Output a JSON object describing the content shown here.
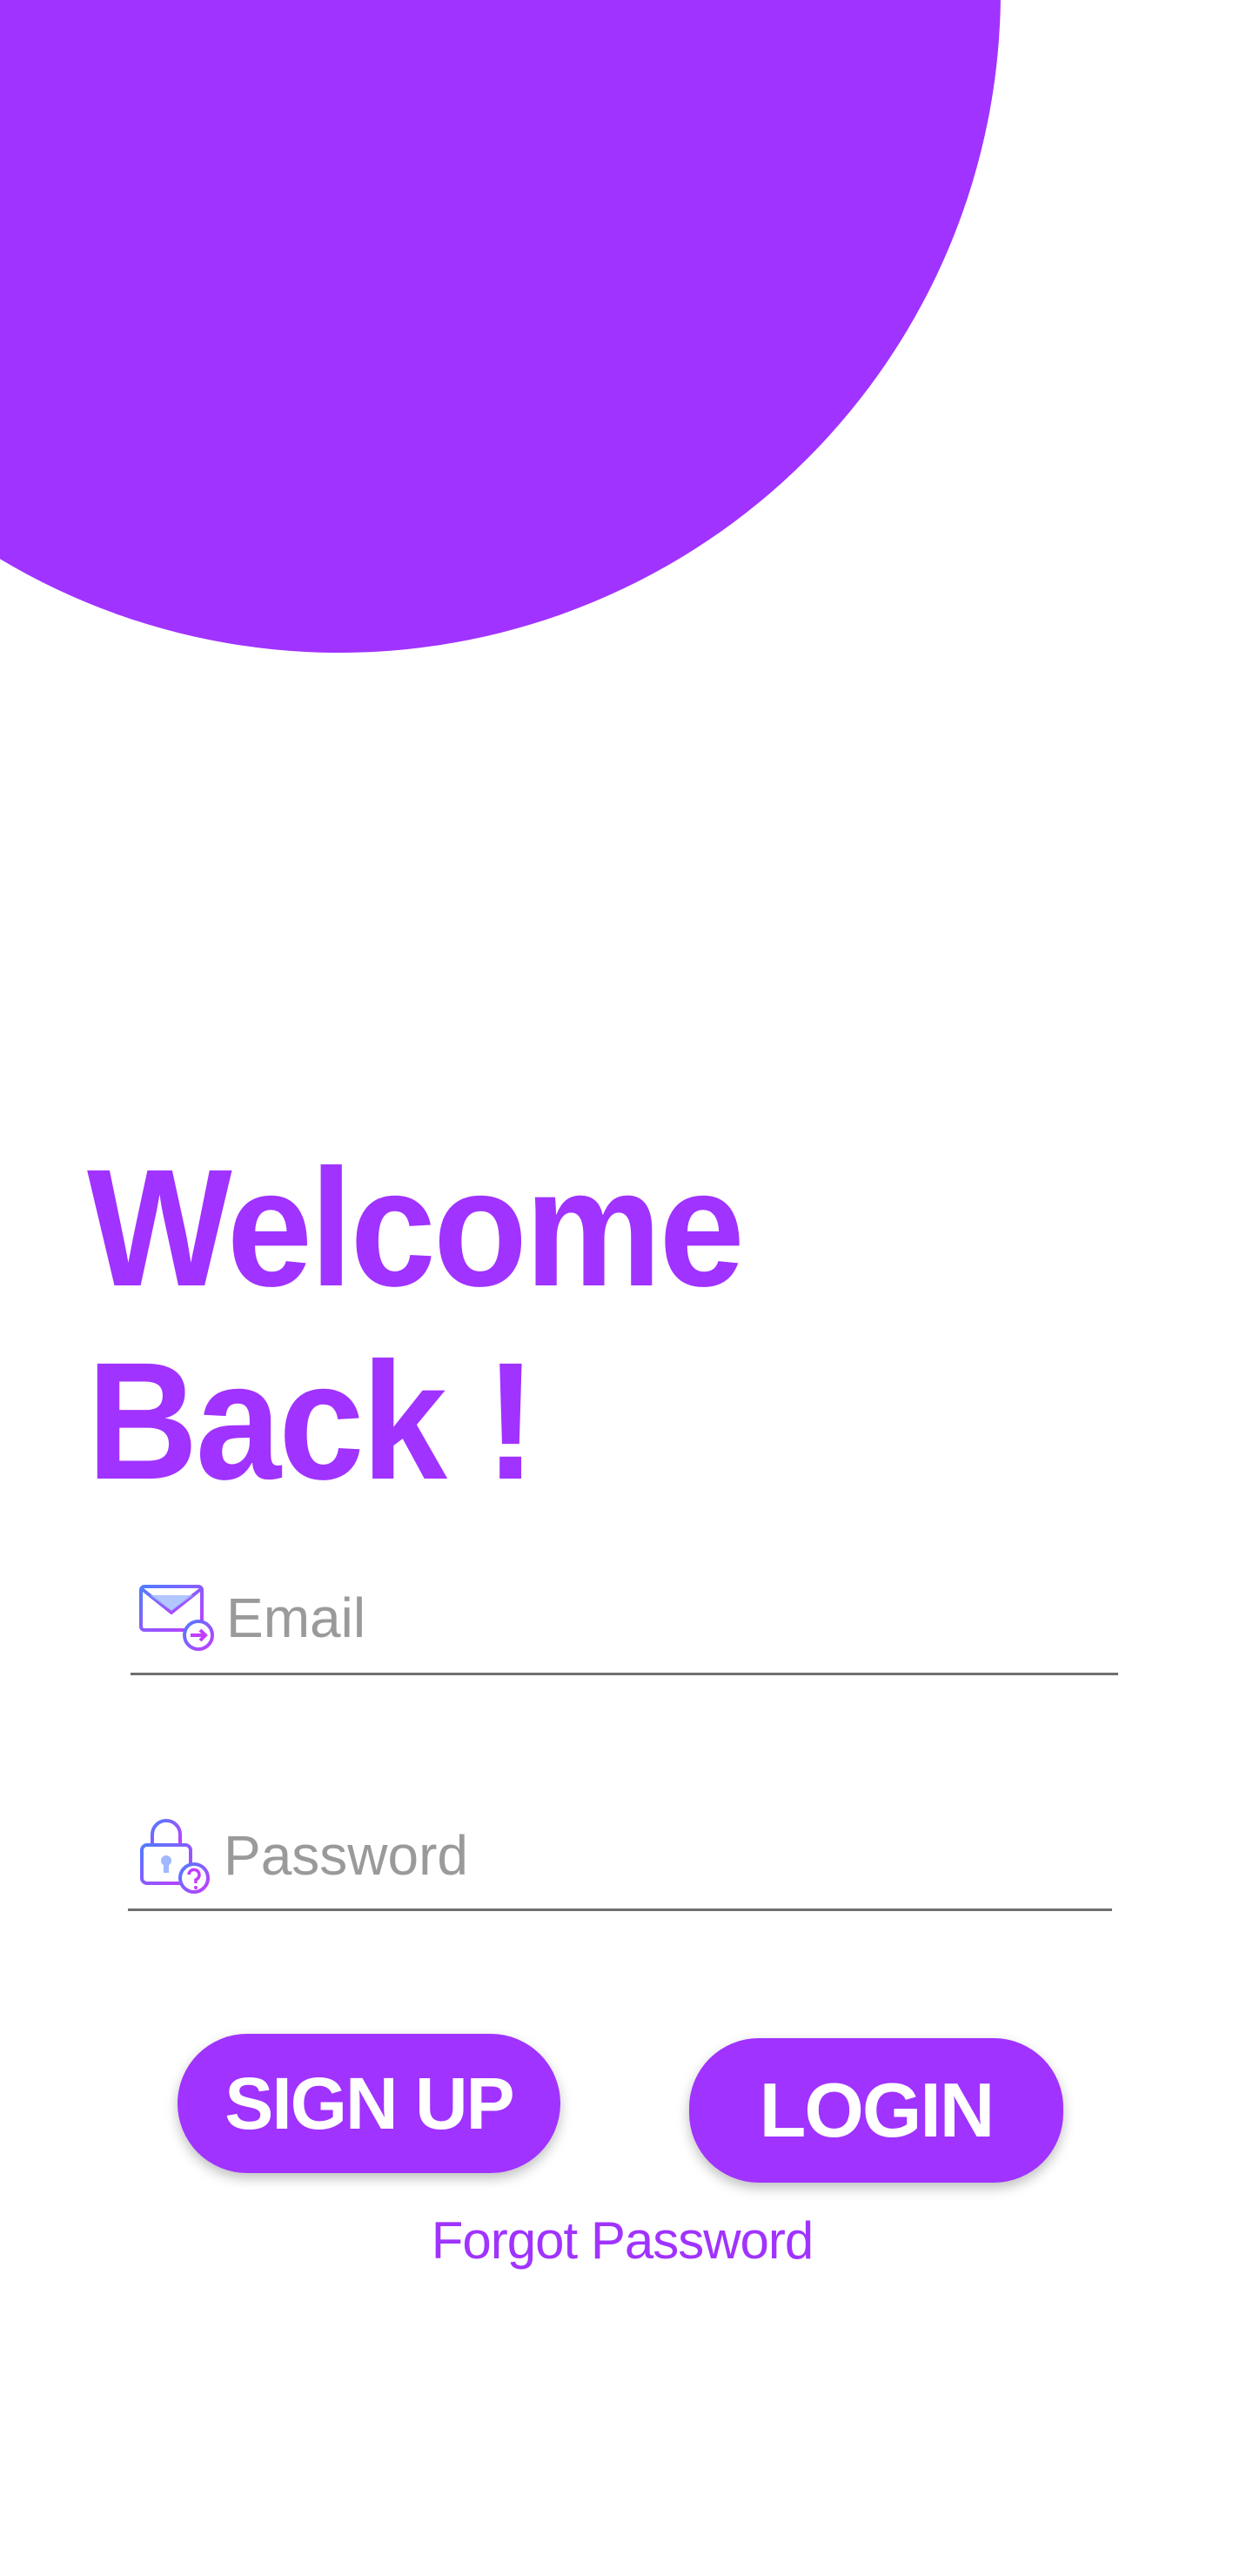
{
  "colors": {
    "accent": "#a033ff",
    "background": "#ffffff",
    "placeholder": "#9a9a9a",
    "underline": "#6f6f6f"
  },
  "welcome": {
    "line1": "Welcome",
    "line2": "Back !"
  },
  "form": {
    "email": {
      "placeholder": "Email",
      "value": "",
      "icon": "email-icon"
    },
    "password": {
      "placeholder": "Password",
      "value": "",
      "icon": "lock-icon"
    }
  },
  "buttons": {
    "signup_label": "SIGN UP",
    "login_label": "LOGIN"
  },
  "links": {
    "forgot_password": "Forgot Password"
  }
}
